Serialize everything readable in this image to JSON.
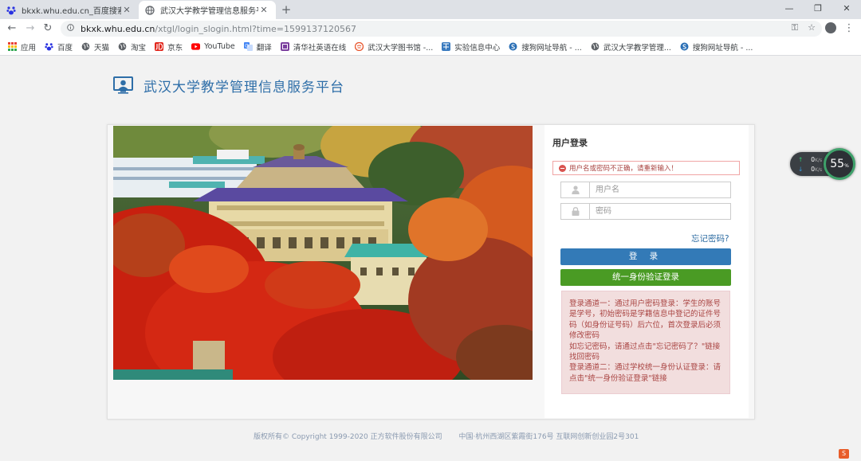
{
  "tabs": [
    {
      "title": "bkxk.whu.edu.cn_百度搜索",
      "active": false,
      "close": "✕"
    },
    {
      "title": "武汉大学教学管理信息服务平台",
      "active": true,
      "close": "✕"
    }
  ],
  "new_tab": "+",
  "window": {
    "minimize": "—",
    "maximize": "❐",
    "close": "✕"
  },
  "nav": {
    "back": "←",
    "forward": "→",
    "reload": "↻"
  },
  "address": {
    "host": "bkxk.whu.edu.cn",
    "path": "/xtgl/login_slogin.html?time=1599137120567",
    "key_icon": "⚿",
    "star_icon": "☆"
  },
  "menu_icon": "⋮",
  "bookmarks": [
    {
      "label": "应用",
      "icon": "apps-grid-icon",
      "color": "#e94235"
    },
    {
      "label": "百度",
      "icon": "baidu-icon",
      "color": "#2932e1"
    },
    {
      "label": "天猫",
      "icon": "globe-icon",
      "color": "#5f6368"
    },
    {
      "label": "淘宝",
      "icon": "globe-icon",
      "color": "#5f6368"
    },
    {
      "label": "京东",
      "icon": "jd-icon",
      "color": "#e1251b"
    },
    {
      "label": "YouTube",
      "icon": "youtube-icon",
      "color": "#ff0000"
    },
    {
      "label": "翻译",
      "icon": "translate-icon",
      "color": "#4285f4"
    },
    {
      "label": "清华社英语在线",
      "icon": "tsinghua-icon",
      "color": "#7b3f9e"
    },
    {
      "label": "武汉大学图书馆 -...",
      "icon": "library-icon",
      "color": "#e8542b"
    },
    {
      "label": "实验信息中心",
      "icon": "lab-icon",
      "color": "#3a7bbf"
    },
    {
      "label": "搜狗网址导航 - ...",
      "icon": "sogou-icon",
      "color": "#2a6fb5"
    },
    {
      "label": "武汉大学教学管理...",
      "icon": "globe-icon",
      "color": "#5f6368"
    },
    {
      "label": "搜狗网址导航 - ...",
      "icon": "sogou-icon",
      "color": "#2a6fb5"
    }
  ],
  "site": {
    "title": "武汉大学教学管理信息服务平台"
  },
  "login": {
    "heading": "用户登录",
    "error": "用户名或密码不正确，请重新输入！",
    "username_placeholder": "用户名",
    "password_placeholder": "密码",
    "forgot": "忘记密码?",
    "login_button": "登 录",
    "sso_button": "统一身份验证登录",
    "notice": [
      "登录通道一：通过用户密码登录：学生的账号是学号，初始密码是学籍信息中登记的证件号码（如身份证号码）后六位，首次登录后必须修改密码",
      "如忘记密码，请通过点击\"忘记密码了？\"链接找回密码",
      "登录通道二：通过学校统一身份认证登录：请点击\"统一身份验证登录\"链接"
    ]
  },
  "footer": {
    "copyright": "版权所有© Copyright 1999-2020 正方软件股份有限公司",
    "address": "中国·杭州西湖区紫霞街176号 互联网创新创业园2号301"
  },
  "speed_widget": {
    "up": "0",
    "down": "0",
    "unit": "K/s",
    "percent": "55",
    "percent_sign": "%"
  },
  "colors": {
    "primary": "#337ab7",
    "sso": "#4a9b24",
    "error": "#a94442",
    "title": "#2e6ea8"
  }
}
